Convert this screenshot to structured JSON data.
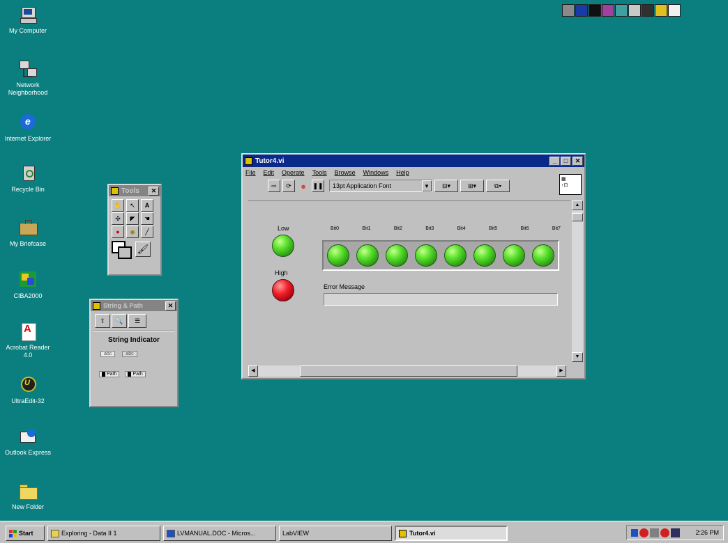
{
  "desktop_icons": [
    {
      "label": "My Computer",
      "icon": "computer-icon"
    },
    {
      "label": "Network Neighborhood",
      "icon": "network-icon"
    },
    {
      "label": "Internet Explorer",
      "icon": "ie-icon"
    },
    {
      "label": "Recycle Bin",
      "icon": "recycle-bin-icon"
    },
    {
      "label": "My Briefcase",
      "icon": "briefcase-icon"
    },
    {
      "label": "CIBA2000",
      "icon": "ciba-icon"
    },
    {
      "label": "Acrobat Reader 4.0",
      "icon": "acrobat-icon"
    },
    {
      "label": "UltraEdit-32",
      "icon": "ultraedit-icon"
    },
    {
      "label": "Outlook Express",
      "icon": "outlook-icon"
    },
    {
      "label": "New Folder",
      "icon": "folder-icon"
    }
  ],
  "tools_palette": {
    "title": "Tools"
  },
  "string_palette": {
    "title": "String & Path",
    "section": "String Indicator",
    "chip_a": "abc",
    "chip_b": "abc",
    "path_a": "Path",
    "path_b": "Path"
  },
  "vi_window": {
    "title": "Tutor4.vi",
    "menu": [
      "File",
      "Edit",
      "Operate",
      "Tools",
      "Browse",
      "Windows",
      "Help"
    ],
    "font_select": "13pt Application Font",
    "low_label": "Low",
    "high_label": "High",
    "bit_labels": [
      "Bit0",
      "Bit1",
      "Bit2",
      "Bit3",
      "Bit4",
      "Bit5",
      "Bit6",
      "Bit7"
    ],
    "error_label": "Error Message",
    "error_value": ""
  },
  "taskbar": {
    "start": "Start",
    "buttons": [
      "Exploring - Data II 1",
      "LVMANUAL.DOC - Micros...",
      "LabVIEW",
      "Tutor4.vi"
    ],
    "clock": "2:26 PM"
  },
  "colors": {
    "desktop": "#0b7f7f",
    "active_title": "#0a2a8a",
    "led_on": "#5ce22e",
    "led_alarm": "#f0202a"
  }
}
